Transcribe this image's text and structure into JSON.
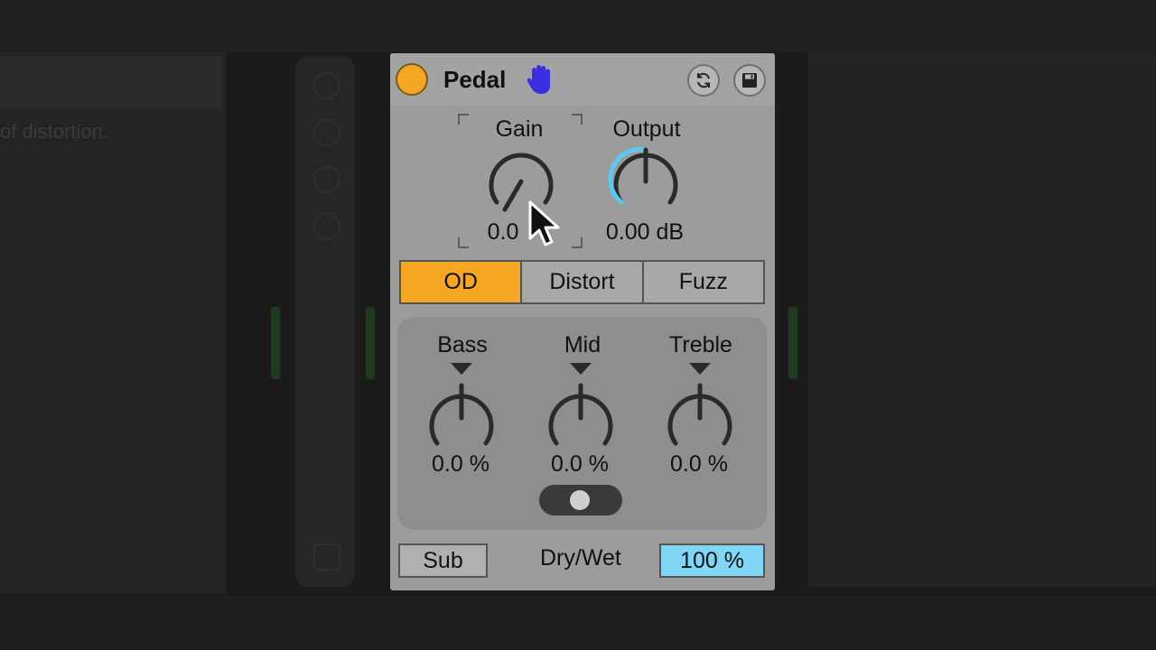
{
  "background": {
    "left_panel_text": "of distortion."
  },
  "device": {
    "title": "Pedal",
    "icons": {
      "power": "power-toggle-icon",
      "hand": "hand-icon",
      "hot_swap": "hot-swap-icon",
      "save": "save-icon"
    },
    "gain": {
      "label": "Gain",
      "value": "0.0"
    },
    "output": {
      "label": "Output",
      "value": "0.00 dB"
    },
    "modes": [
      {
        "label": "OD",
        "active": true
      },
      {
        "label": "Distort",
        "active": false
      },
      {
        "label": "Fuzz",
        "active": false
      }
    ],
    "eq": {
      "bass": {
        "label": "Bass",
        "value": "0.0 %"
      },
      "mid": {
        "label": "Mid",
        "value": "0.0 %"
      },
      "treble": {
        "label": "Treble",
        "value": "0.0 %"
      }
    },
    "sub_label": "Sub",
    "dry_wet_label": "Dry/Wet",
    "dry_wet_value": "100 %"
  },
  "colors": {
    "accent_orange": "#f5a623",
    "accent_blue": "#7fd7f5",
    "device_body": "#9c9c9c",
    "hand_icon": "#3a2fe0"
  }
}
